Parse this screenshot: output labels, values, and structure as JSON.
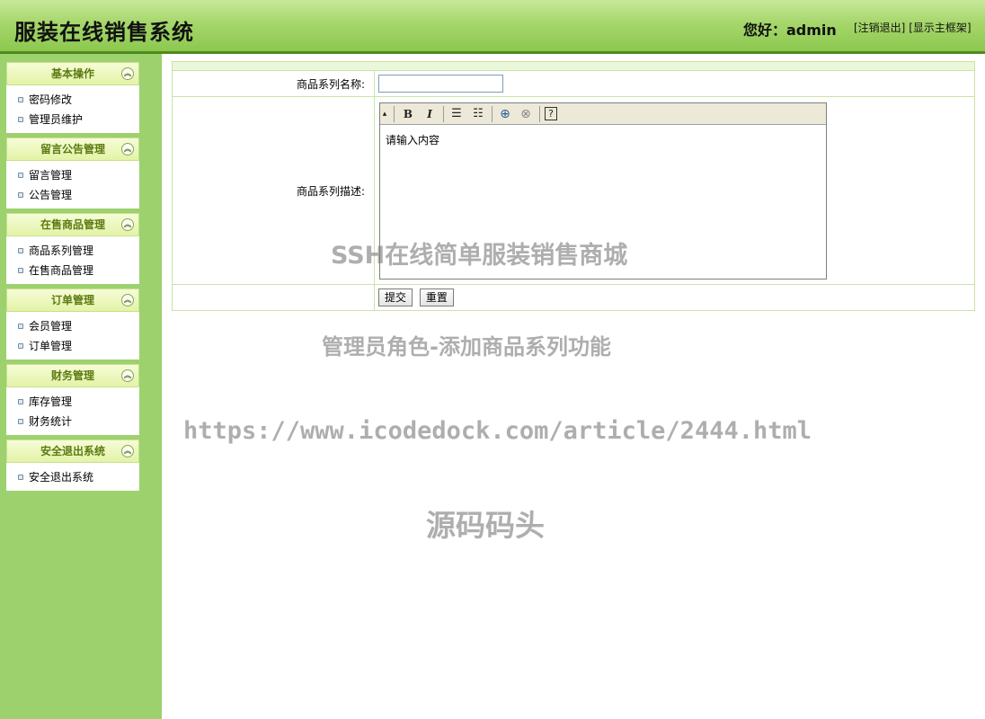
{
  "header": {
    "title": "服装在线销售系统",
    "greeting": "您好：admin",
    "logout_label": "[注销退出]",
    "show_frame_label": "[显示主框架]"
  },
  "sidebar": {
    "panels": [
      {
        "title": "基本操作",
        "items": [
          "密码修改",
          "管理员维护"
        ]
      },
      {
        "title": "留言公告管理",
        "items": [
          "留言管理",
          "公告管理"
        ]
      },
      {
        "title": "在售商品管理",
        "items": [
          "商品系列管理",
          "在售商品管理"
        ]
      },
      {
        "title": "订单管理",
        "items": [
          "会员管理",
          "订单管理"
        ]
      },
      {
        "title": "财务管理",
        "items": [
          "库存管理",
          "财务统计"
        ]
      },
      {
        "title": "安全退出系统",
        "items": [
          "安全退出系统"
        ]
      }
    ]
  },
  "form": {
    "name_label": "商品系列名称:",
    "name_value": "",
    "desc_label": "商品系列描述:",
    "editor_content": "请输入内容",
    "submit_label": "提交",
    "reset_label": "重置"
  },
  "editor_toolbar": [
    "bold-icon",
    "italic-icon",
    "ordered-list-icon",
    "unordered-list-icon",
    "link-icon",
    "unlink-icon",
    "help-icon"
  ],
  "watermarks": {
    "line1": "SSH在线简单服装销售商城",
    "line2": "管理员角色-添加商品系列功能",
    "line3": "https://www.icodedock.com/article/2444.html",
    "line4": "源码码头"
  }
}
